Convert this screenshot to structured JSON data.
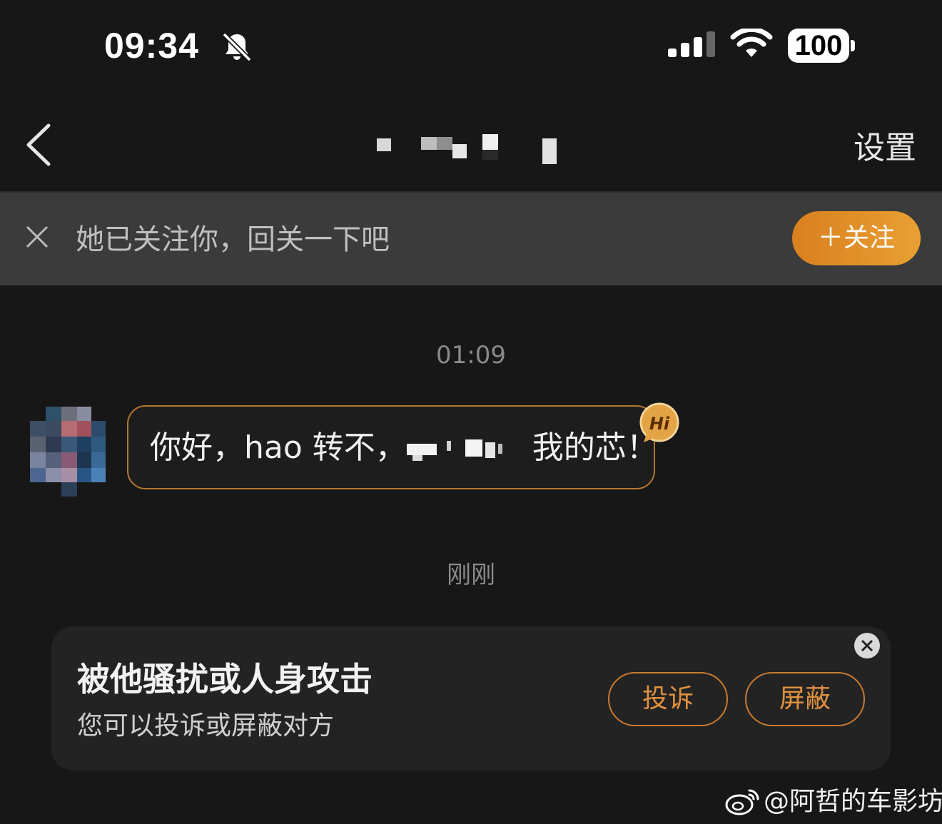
{
  "status_bar": {
    "time": "09:34",
    "battery": "100",
    "icons": [
      "bell-slash-icon",
      "cellular-signal-icon",
      "wifi-icon",
      "battery-icon"
    ]
  },
  "header": {
    "settings_label": "设置",
    "icons": [
      "chevron-left-icon"
    ]
  },
  "follow_banner": {
    "text": "她已关注你，回关一下吧",
    "follow_button": "＋关注",
    "accent": "#e08a28"
  },
  "chat": {
    "timestamp_1": "01:09",
    "message_before": "你好，hao 转不，",
    "message_after": "我的芯！",
    "badge_text": "Hi",
    "timestamp_2": "刚刚",
    "bubble_border_color": "#b5772b"
  },
  "report_card": {
    "title": "被他骚扰或人身攻击",
    "subtitle": "您可以投诉或屏蔽对方",
    "report_button": "投诉",
    "block_button": "屏蔽",
    "button_color": "#e0913f"
  },
  "watermark": {
    "text": "@阿哲的车影坊"
  }
}
